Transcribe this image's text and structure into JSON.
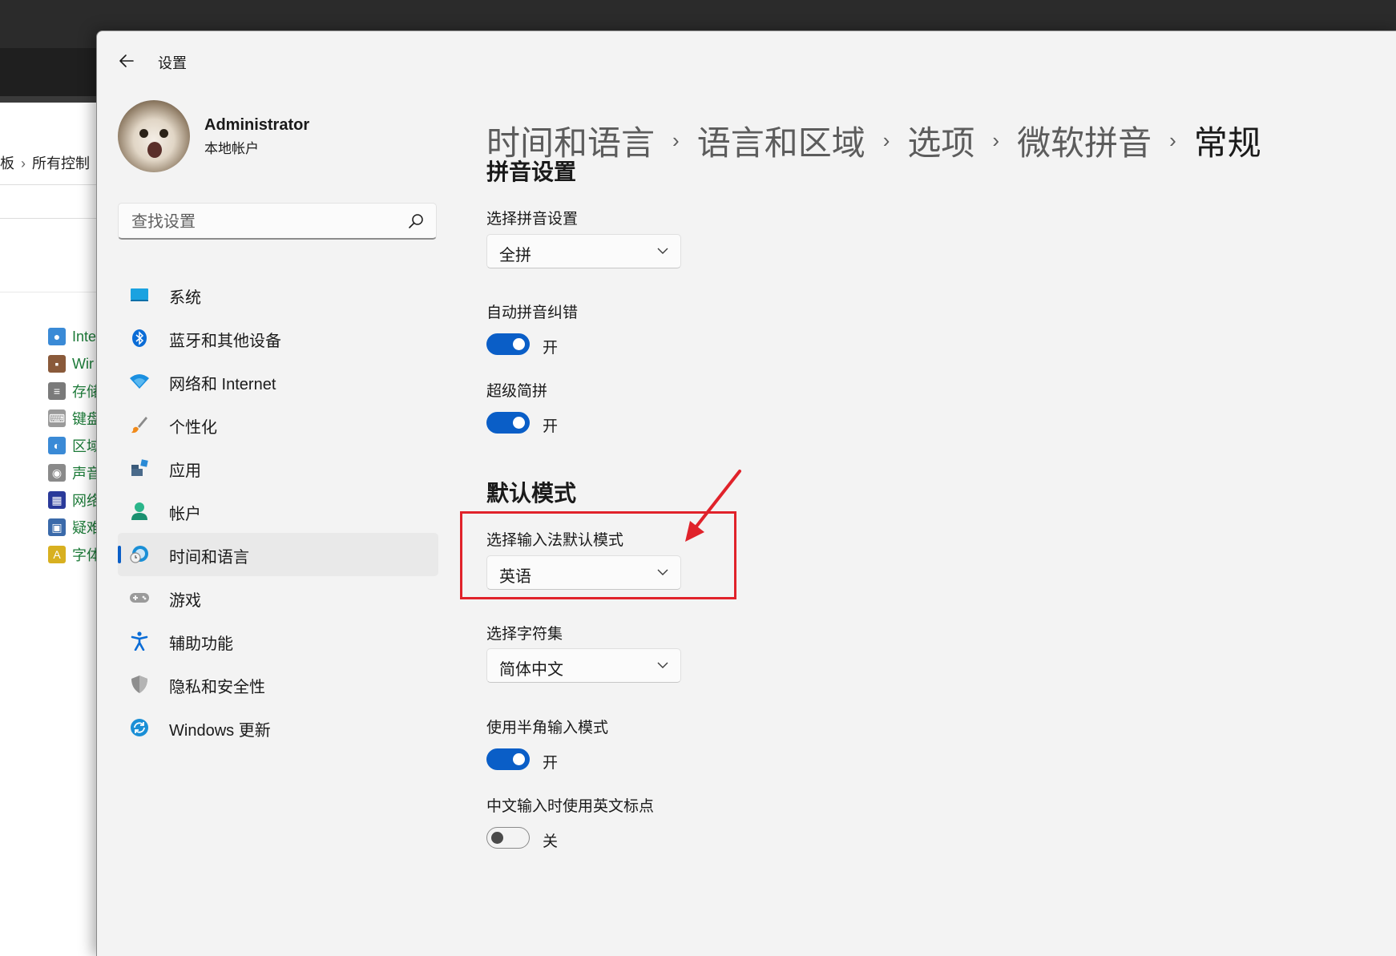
{
  "background_window": {
    "breadcrumb": [
      "板",
      "所有控制"
    ],
    "items": [
      {
        "label": "Inte",
        "color": "#3a8ad6"
      },
      {
        "label": "Wir",
        "color": "#8a5a3a"
      },
      {
        "label": "存储",
        "color": "#7a7a7a"
      },
      {
        "label": "键盘",
        "color": "#9a9a9a"
      },
      {
        "label": "区域",
        "color": "#3a8ad6"
      },
      {
        "label": "声音",
        "color": "#8a8a8a"
      },
      {
        "label": "网络",
        "color": "#2a3a9a"
      },
      {
        "label": "疑难",
        "color": "#3a6aaa"
      },
      {
        "label": "字体",
        "color": "#d8b020"
      }
    ]
  },
  "window": {
    "title": "设置"
  },
  "profile": {
    "name": "Administrator",
    "account_type": "本地帐户"
  },
  "search": {
    "placeholder": "查找设置"
  },
  "nav": {
    "items": [
      {
        "label": "系统",
        "icon": "system-icon",
        "active": false
      },
      {
        "label": "蓝牙和其他设备",
        "icon": "bluetooth-icon",
        "active": false
      },
      {
        "label": "网络和 Internet",
        "icon": "wifi-icon",
        "active": false
      },
      {
        "label": "个性化",
        "icon": "brush-icon",
        "active": false
      },
      {
        "label": "应用",
        "icon": "apps-icon",
        "active": false
      },
      {
        "label": "帐户",
        "icon": "account-icon",
        "active": false
      },
      {
        "label": "时间和语言",
        "icon": "time-language-icon",
        "active": true
      },
      {
        "label": "游戏",
        "icon": "gamepad-icon",
        "active": false
      },
      {
        "label": "辅助功能",
        "icon": "accessibility-icon",
        "active": false
      },
      {
        "label": "隐私和安全性",
        "icon": "shield-icon",
        "active": false
      },
      {
        "label": "Windows 更新",
        "icon": "update-icon",
        "active": false
      }
    ]
  },
  "breadcrumb": [
    "时间和语言",
    "语言和区域",
    "选项",
    "微软拼音",
    "常规"
  ],
  "sections": {
    "pinyin": {
      "title": "拼音设置",
      "pinyin_setting": {
        "label": "选择拼音设置",
        "value": "全拼"
      },
      "auto_correct": {
        "label": "自动拼音纠错",
        "state": "开",
        "on": true
      },
      "super_jianpin": {
        "label": "超级简拼",
        "state": "开",
        "on": true
      }
    },
    "default_mode": {
      "title": "默认模式",
      "ime_default_mode": {
        "label": "选择输入法默认模式",
        "value": "英语"
      },
      "charset": {
        "label": "选择字符集",
        "value": "简体中文"
      },
      "half_width": {
        "label": "使用半角输入模式",
        "state": "开",
        "on": true
      },
      "english_punct": {
        "label": "中文输入时使用英文标点",
        "state": "关",
        "on": false
      }
    }
  },
  "colors": {
    "accent": "#0a5ec7",
    "annotation": "#e0222a",
    "bg": "#f3f3f3"
  }
}
